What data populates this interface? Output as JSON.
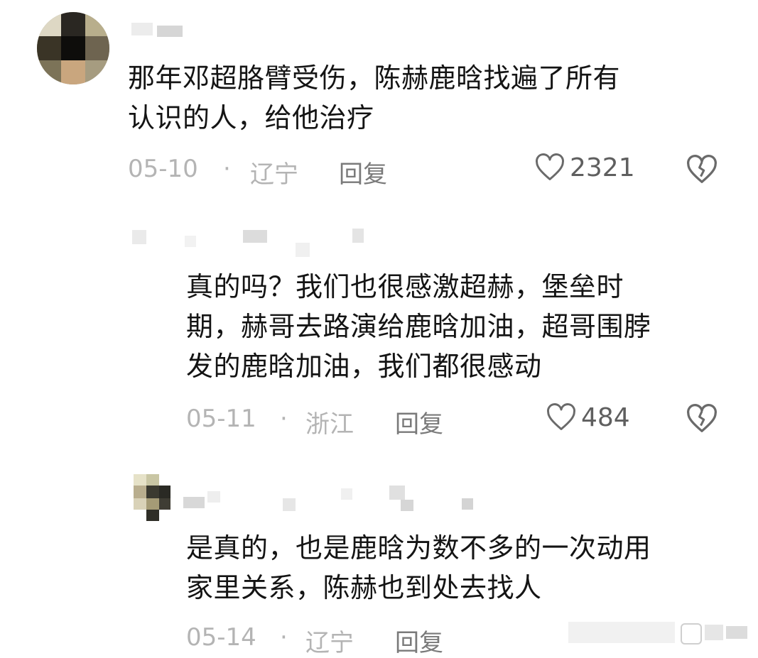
{
  "comments": [
    {
      "text": "那年邓超胳臂受伤，陈赫鹿晗找遍了所有\n认识的人，给他治疗",
      "date": "05-10",
      "separator": "·",
      "region": "辽宁",
      "reply_label": "回复",
      "likes": "2321"
    },
    {
      "text": "真的吗？我们也很感激超赫，堡垒时\n期，赫哥去路演给鹿晗加油，超哥围脖\n发的鹿晗加油，我们都很感动",
      "date": "05-11",
      "separator": "·",
      "region": "浙江",
      "reply_label": "回复",
      "likes": "484"
    },
    {
      "text": "是真的，也是鹿晗为数不多的一次动用\n家里关系，陈赫也到处去找人",
      "date": "05-14",
      "separator": "·",
      "region": "辽宁",
      "reply_label": "回复"
    }
  ],
  "icons": {
    "like": "heart-outline-icon",
    "dislike": "broken-heart-icon"
  },
  "colors": {
    "text": "#141414",
    "meta": "#b4b4b4",
    "reply": "#7a7a7a",
    "icon": "#6a6a6a"
  }
}
